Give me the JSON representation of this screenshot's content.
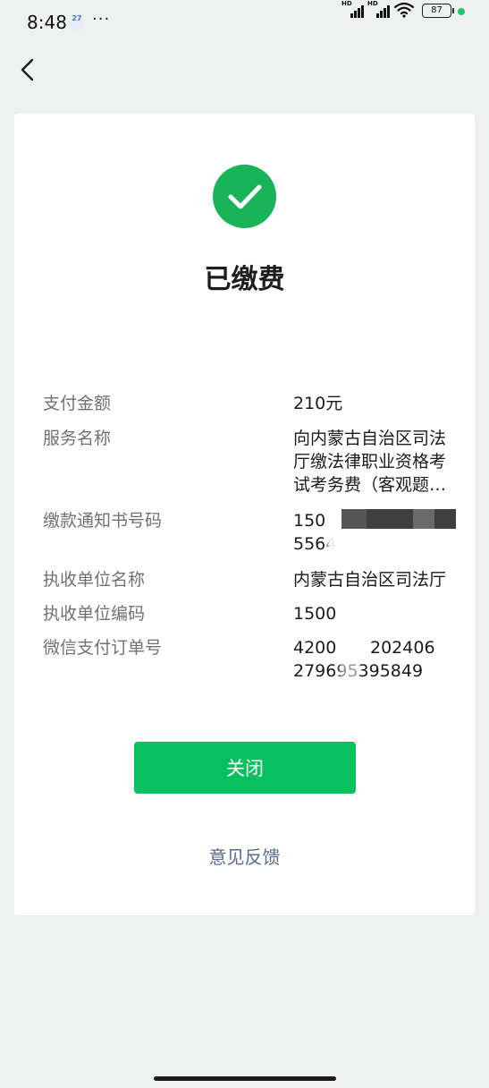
{
  "status_bar": {
    "time": "8:48",
    "calendar_day": "27",
    "more": "···",
    "signal_1_label": "HD",
    "signal_2_label": "HD",
    "battery": "87",
    "accent": "#1ec760"
  },
  "nav": {
    "back_icon": "chevron-left-icon"
  },
  "result": {
    "icon": "check-circle-icon",
    "icon_color": "#19b457",
    "title": "已缴费"
  },
  "details": [
    {
      "label": "支付金额",
      "value": "210元"
    },
    {
      "label": "服务名称",
      "value": "向内蒙古自治区司法厅缴法律职业资格考试考务费（客观题…"
    },
    {
      "label": "缴款通知书号码",
      "value_line1": "150",
      "value_line2": "5564"
    },
    {
      "label": "执收单位名称",
      "value": "内蒙古自治区司法厅"
    },
    {
      "label": "执收单位编码",
      "value": "1500"
    },
    {
      "label": "微信支付订单号",
      "value_line1_start": "4200",
      "value_line1_end": "202406",
      "value_line2": "279695395849"
    }
  ],
  "actions": {
    "close_label": "关闭",
    "close_color": "#07c160",
    "feedback_label": "意见反馈",
    "feedback_color": "#576b95"
  }
}
